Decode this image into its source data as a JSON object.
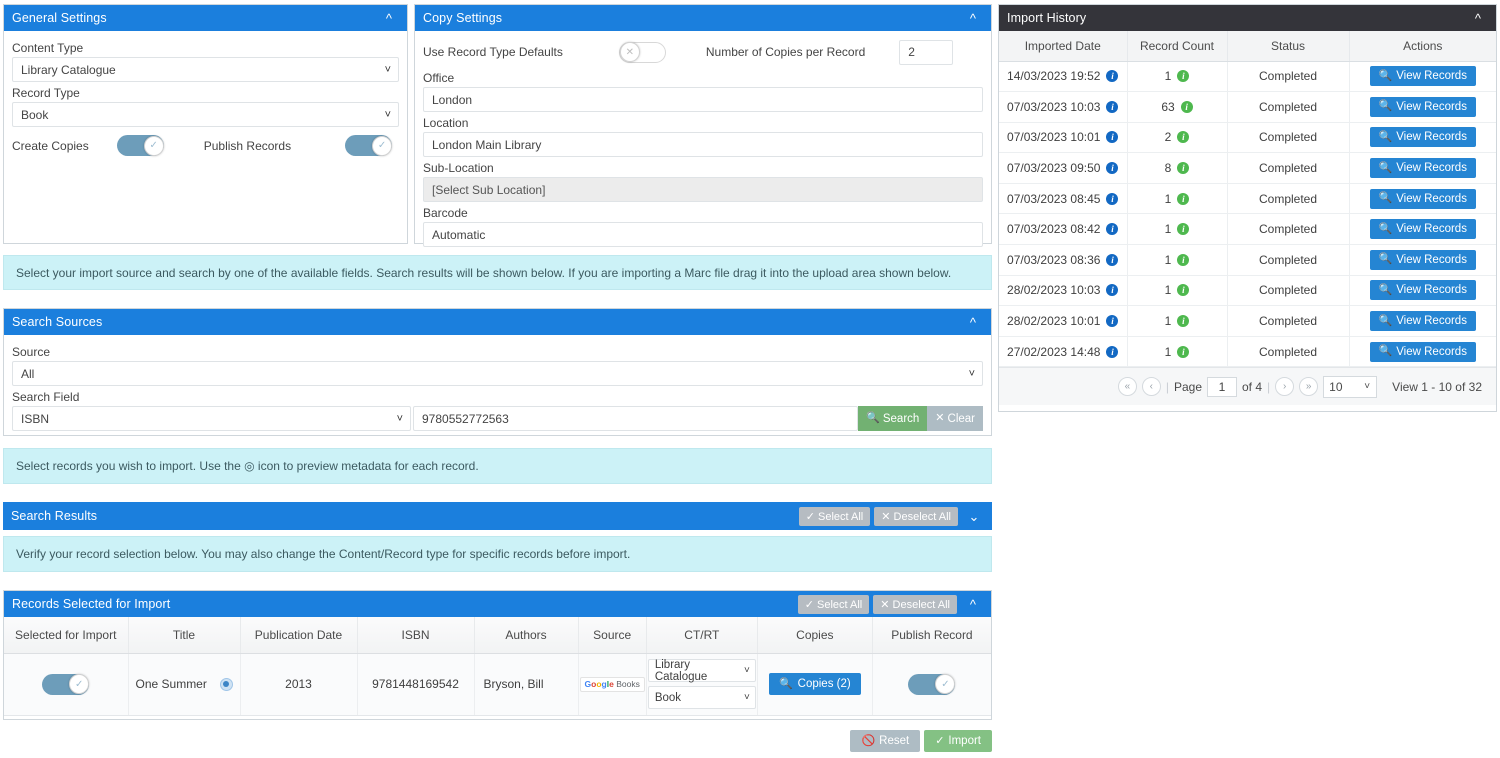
{
  "general_settings": {
    "title": "General Settings",
    "collapse_icon": "chevron-up",
    "content_type_label": "Content Type",
    "content_type_value": "Library Catalogue",
    "record_type_label": "Record Type",
    "record_type_value": "Book",
    "create_copies_label": "Create Copies",
    "create_copies_state": "on",
    "publish_records_label": "Publish Records",
    "publish_records_state": "on"
  },
  "copy_settings": {
    "title": "Copy Settings",
    "collapse_icon": "chevron-up",
    "use_defaults_label": "Use Record Type Defaults",
    "use_defaults_state": "off",
    "copies_per_record_label": "Number of Copies per Record",
    "copies_per_record_value": "2",
    "office_label": "Office",
    "office_value": "London",
    "location_label": "Location",
    "location_value": "London Main Library",
    "sub_location_label": "Sub-Location",
    "sub_location_value": "[Select Sub Location]",
    "barcode_label": "Barcode",
    "barcode_value": "Automatic"
  },
  "banner_source": "Select your import source and search by one of the available fields. Search results will be shown below. If you are importing a Marc file drag it into the upload area shown below.",
  "search_sources": {
    "title": "Search Sources",
    "collapse_icon": "chevron-up",
    "source_label": "Source",
    "source_value": "All",
    "search_field_label": "Search Field",
    "search_field_value": "ISBN",
    "query_value": "9780552772563",
    "search_button": "Search",
    "search_icon": "magnifier-icon",
    "clear_button": "Clear",
    "clear_icon": "close-icon"
  },
  "banner_select": "Select records you wish to import. Use the ◎ icon to preview metadata for each record.",
  "search_results": {
    "title": "Search Results",
    "select_all": "Select All",
    "deselect_all": "Deselect All",
    "collapse_icon": "chevron-down"
  },
  "banner_verify": "Verify your record selection below. You may also change the Content/Record type for specific records before import.",
  "records_selected": {
    "title": "Records Selected for Import",
    "select_all": "Select All",
    "deselect_all": "Deselect All",
    "collapse_icon": "chevron-up",
    "columns": [
      "Selected for Import",
      "Title",
      "Publication Date",
      "ISBN",
      "Authors",
      "Source",
      "CT/RT",
      "Copies",
      "Publish Record"
    ],
    "row": {
      "selected_state": "on",
      "title": "One Summer",
      "preview_icon": "preview-circle-icon",
      "publication_date": "2013",
      "isbn": "9781448169542",
      "authors": "Bryson, Bill",
      "source": "Google Books",
      "content_type": "Library Catalogue",
      "record_type": "Book",
      "copies_button": "Copies (2)",
      "copies_icon": "magnifier-icon",
      "publish_state": "on"
    },
    "reset_button": "Reset",
    "reset_icon": "ban-icon",
    "import_button": "Import",
    "import_icon": "check-icon"
  },
  "import_history": {
    "title": "Import History",
    "collapse_icon": "chevron-up",
    "columns": [
      "Imported Date",
      "Record Count",
      "Status",
      "Actions"
    ],
    "action_label": "View Records",
    "action_icon": "magnifier-icon",
    "rows": [
      {
        "date": "14/03/2023 19:52",
        "count": "1",
        "status": "Completed"
      },
      {
        "date": "07/03/2023 10:03",
        "count": "63",
        "status": "Completed"
      },
      {
        "date": "07/03/2023 10:01",
        "count": "2",
        "status": "Completed"
      },
      {
        "date": "07/03/2023 09:50",
        "count": "8",
        "status": "Completed"
      },
      {
        "date": "07/03/2023 08:45",
        "count": "1",
        "status": "Completed"
      },
      {
        "date": "07/03/2023 08:42",
        "count": "1",
        "status": "Completed"
      },
      {
        "date": "07/03/2023 08:36",
        "count": "1",
        "status": "Completed"
      },
      {
        "date": "28/02/2023 10:03",
        "count": "1",
        "status": "Completed"
      },
      {
        "date": "28/02/2023 10:01",
        "count": "1",
        "status": "Completed"
      },
      {
        "date": "27/02/2023 14:48",
        "count": "1",
        "status": "Completed"
      }
    ],
    "pager": {
      "first_icon": "double-chevron-left-icon",
      "prev_icon": "chevron-left-icon",
      "page_label": "Page",
      "page_value": "1",
      "of_label": "of 4",
      "next_icon": "chevron-right-icon",
      "last_icon": "double-chevron-right-icon",
      "page_size": "10",
      "view_text": "View 1 - 10 of 32"
    }
  },
  "colors": {
    "panel_header_blue": "#1b7fdd",
    "panel_header_dark": "#34343a",
    "banner_cyan": "#ccf2f7",
    "primary_blue": "#2585d3",
    "success_green": "#72b172",
    "toggle_on": "#6d9dba"
  }
}
